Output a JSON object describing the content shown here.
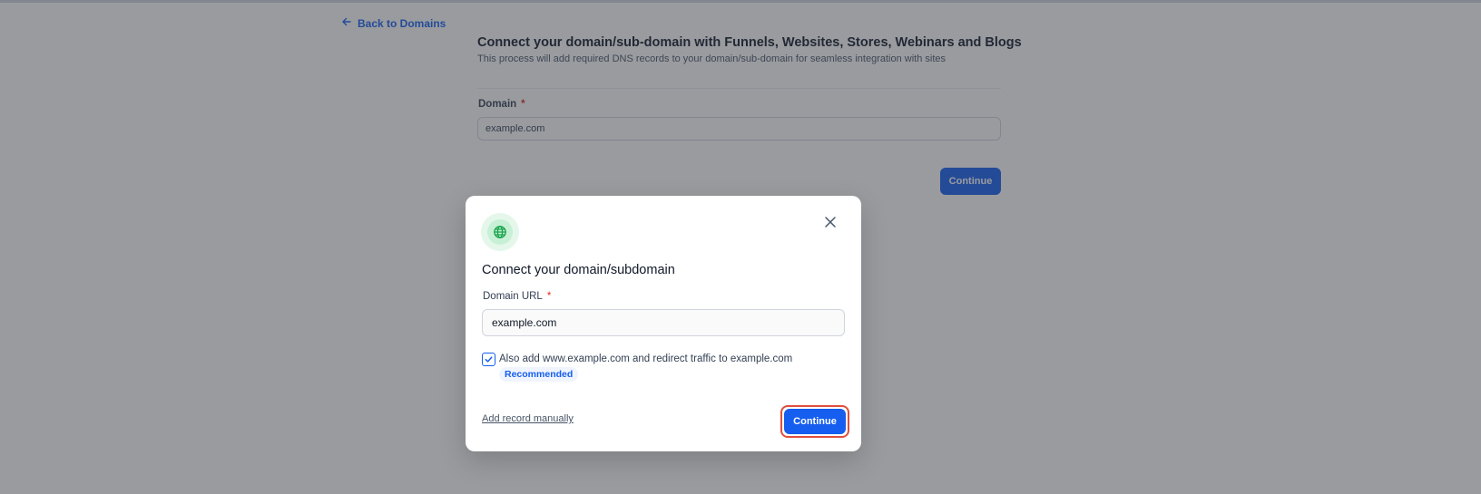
{
  "page": {
    "back_label": "Back to Domains",
    "title": "Connect your domain/sub-domain with Funnels, Websites, Stores, Webinars and Blogs",
    "subtitle": "This process will add required DNS records to your domain/sub-domain for seamless integration with sites",
    "domain_label": "Domain",
    "required_mark": "*",
    "domain_value": "example.com",
    "continue_label": "Continue"
  },
  "modal": {
    "icon": "globe-icon",
    "close_icon": "close-icon",
    "title": "Connect your domain/subdomain",
    "url_label": "Domain URL",
    "required_mark": "*",
    "url_value": "example.com",
    "www_checkbox": {
      "checked": true,
      "label": "Also add www.example.com and redirect traffic to example.com",
      "badge": "Recommended"
    },
    "add_manual_label": "Add record manually",
    "continue_label": "Continue"
  },
  "colors": {
    "accent": "#155eef",
    "highlight_ring": "#e04f3c",
    "icon_bg": "#e4f7ea",
    "icon_fg": "#16a34a",
    "overlay": "rgba(52,56,64,0.5)"
  }
}
